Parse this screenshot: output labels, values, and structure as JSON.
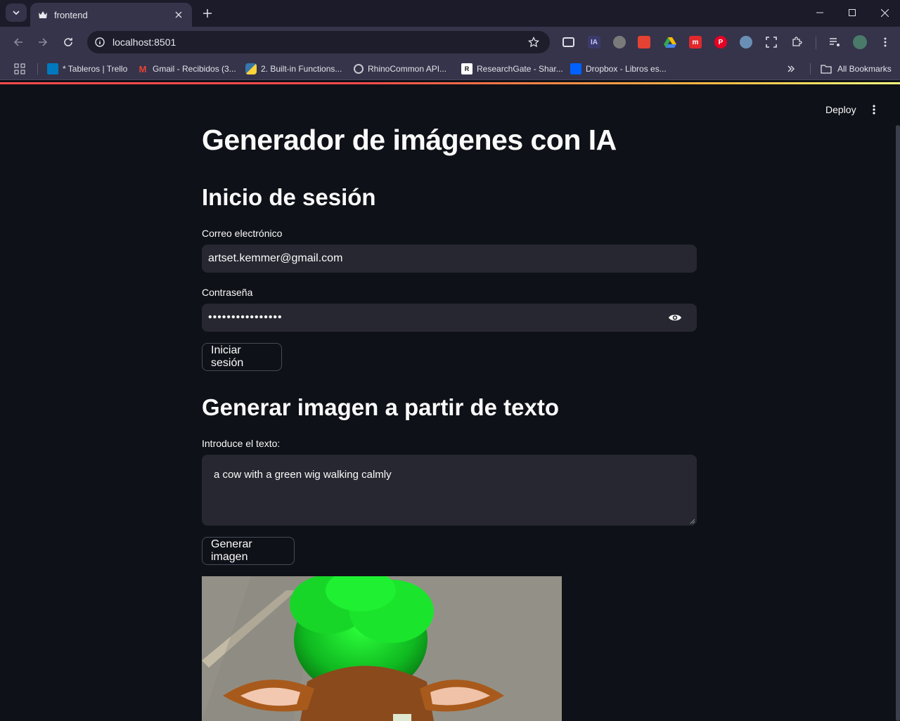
{
  "browser": {
    "tab_title": "frontend",
    "url": "localhost:8501",
    "bookmarks": [
      {
        "label": "* Tableros | Trello",
        "icon": "trello-icon",
        "color": "#0079bf"
      },
      {
        "label": "Gmail - Recibidos (3...",
        "icon": "gmail-icon",
        "color": "#ea4335"
      },
      {
        "label": "2. Built-in Functions...",
        "icon": "python-icon",
        "color": "#3776ab"
      },
      {
        "label": "RhinoCommon API...",
        "icon": "rhino-icon",
        "color": "#6b6b6b"
      },
      {
        "label": "ResearchGate - Shar...",
        "icon": "researchgate-icon",
        "color": "#ffffff"
      },
      {
        "label": "Dropbox - Libros es...",
        "icon": "dropbox-icon",
        "color": "#0061ff"
      }
    ],
    "all_bookmarks": "All Bookmarks"
  },
  "app": {
    "deploy_label": "Deploy",
    "title": "Generador de imágenes con IA",
    "login": {
      "heading": "Inicio de sesión",
      "email_label": "Correo electrónico",
      "email_value": "artset.kemmer@gmail.com",
      "password_label": "Contraseña",
      "password_value": "••••••••••••••••",
      "submit_label": "Iniciar sesión"
    },
    "generate": {
      "heading": "Generar imagen a partir de texto",
      "prompt_label": "Introduce el texto:",
      "prompt_value": "a cow with a green wig walking calmly",
      "submit_label": "Generar imagen"
    }
  },
  "colors": {
    "background": "#0e1117",
    "input_bg": "#262730",
    "accent_gradient_start": "#ff4b4b"
  }
}
